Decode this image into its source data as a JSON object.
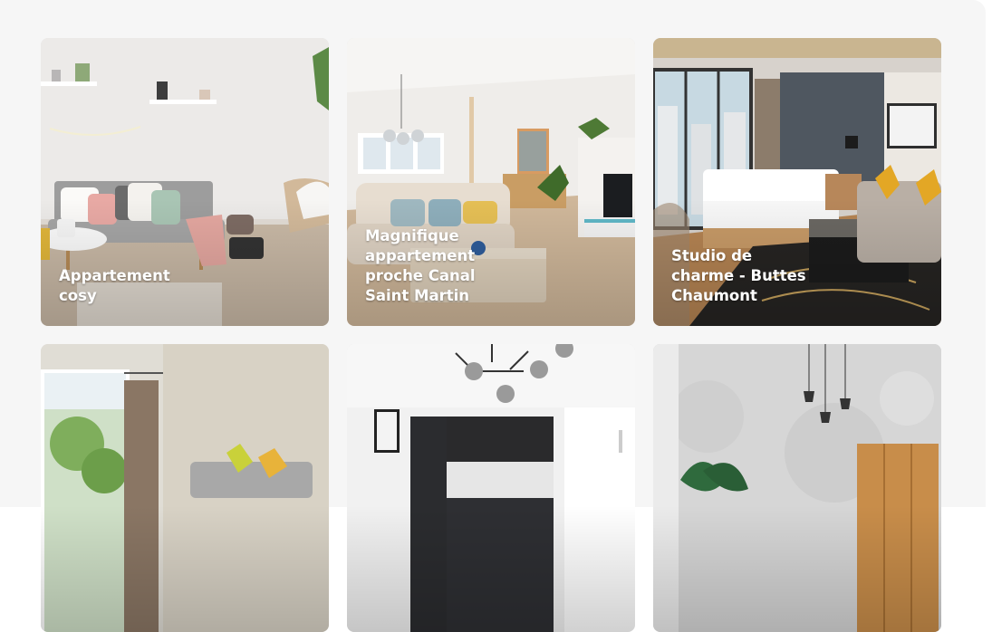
{
  "listings": [
    {
      "title": "Appartement cosy",
      "photo": "living-room-grey-sofa-photo"
    },
    {
      "title": "Magnifique appartement proche Canal Saint Martin",
      "photo": "open-living-room-photo"
    },
    {
      "title": "Studio de charme - Buttes Chaumont",
      "photo": "studio-bedroom-photo"
    },
    {
      "title": "",
      "photo": "living-room-window-photo"
    },
    {
      "title": "",
      "photo": "dark-kitchen-photo"
    },
    {
      "title": "",
      "photo": "concrete-wall-room-photo"
    }
  ]
}
